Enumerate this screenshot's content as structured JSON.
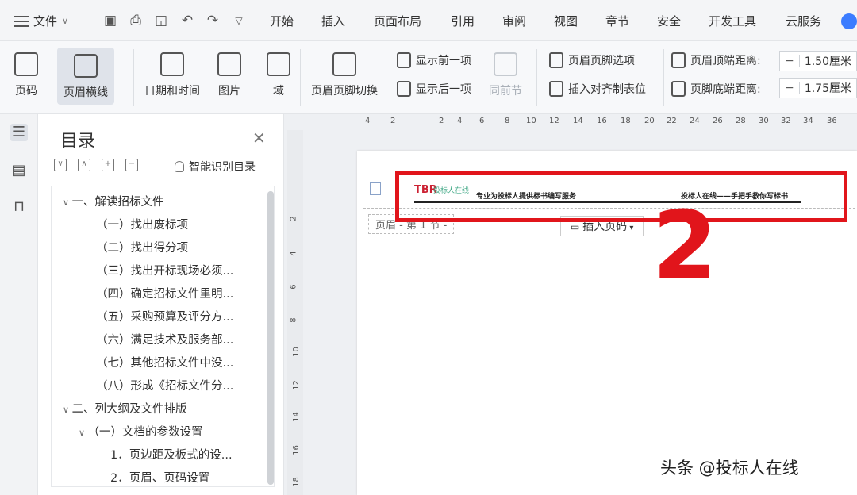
{
  "menubar": {
    "file_label": "文件",
    "tabs": [
      "开始",
      "插入",
      "页面布局",
      "引用",
      "审阅",
      "视图",
      "章节",
      "安全",
      "开发工具",
      "云服务"
    ]
  },
  "ribbon": {
    "page_number": "页码",
    "header_footer": "页眉横线",
    "date_time": "日期和时间",
    "image": "图片",
    "field": "域",
    "switch": "页眉页脚切换",
    "show_prev": "显示前一项",
    "show_next": "显示后一项",
    "same_prev": "同前节",
    "hf_options": "页眉页脚选项",
    "insert_tab": "插入对齐制表位",
    "header_top_label": "页眉顶端距离:",
    "header_top_value": "1.50厘米",
    "footer_bottom_label": "页脚底端距离:",
    "footer_bottom_value": "1.75厘米"
  },
  "toc": {
    "title": "目录",
    "smart_label": "智能识别目录",
    "entries": [
      "一、解读招标文件",
      "（一）找出废标项",
      "（二）找出得分项",
      "（三）找出开标现场必须...",
      "（四）确定招标文件里明...",
      "（五）采购预算及评分方...",
      "（六）满足技术及服务部...",
      "（七）其他招标文件中没...",
      "（八）形成《招标文件分...",
      "二、列大纲及文件排版",
      "（一）文档的参数设置",
      "1．页边距及板式的设...",
      "2．页眉、页码设置"
    ]
  },
  "ruler": {
    "h_ticks": [
      "4",
      "2",
      "2",
      "4",
      "6",
      "8",
      "10",
      "12",
      "14",
      "16",
      "18",
      "20",
      "22",
      "24",
      "26",
      "28",
      "30",
      "32",
      "34",
      "36"
    ],
    "v_ticks": [
      "2",
      "4",
      "6",
      "8",
      "10",
      "12",
      "14",
      "16",
      "18"
    ]
  },
  "page": {
    "header_left": "专业为投标人提供标书编写服务",
    "header_right": "投标人在线——手把手教你写标书",
    "logo_text": "投标人在线",
    "header_tag": "页眉 - 第 1 节 -",
    "insert_page_number": "插入页码",
    "annotation": "2"
  },
  "watermark": "头条 @投标人在线",
  "colors": {
    "accent_red": "#e1151b",
    "cloud_blue": "#3b7cff"
  }
}
